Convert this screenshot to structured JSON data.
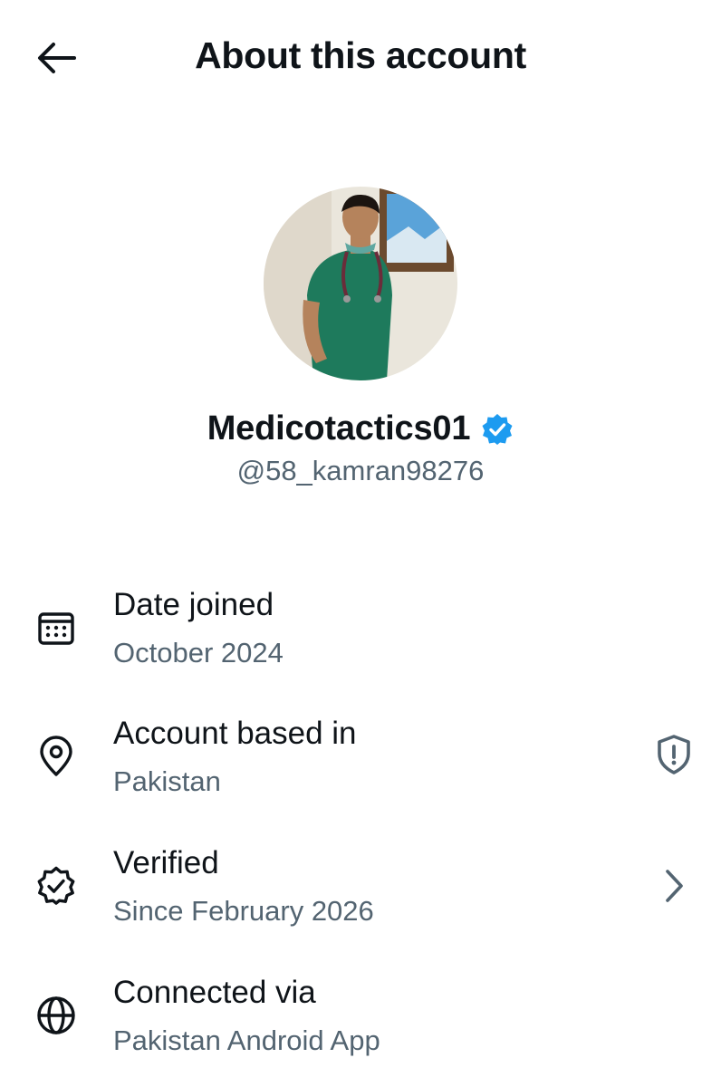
{
  "header": {
    "title": "About this account",
    "back_icon": "arrow-left-icon"
  },
  "profile": {
    "display_name": "Medicotactics01",
    "handle": "@58_kamran98276",
    "verified_badge_color": "#1d9bf0",
    "avatar_alt": "profile photo"
  },
  "details": [
    {
      "title": "Date joined",
      "value": "October 2024",
      "icon": "calendar-icon"
    },
    {
      "title": "Account based in",
      "value": "Pakistan",
      "icon": "location-pin-icon",
      "trailing_icon": "shield-alert-icon"
    },
    {
      "title": "Verified",
      "value": "Since February 2026",
      "icon": "verified-badge-outline-icon",
      "trailing_icon": "chevron-right-icon"
    },
    {
      "title": "Connected via",
      "value": "Pakistan Android App",
      "icon": "globe-icon"
    }
  ],
  "colors": {
    "text_primary": "#0f1419",
    "text_secondary": "#536471",
    "accent": "#1d9bf0"
  }
}
